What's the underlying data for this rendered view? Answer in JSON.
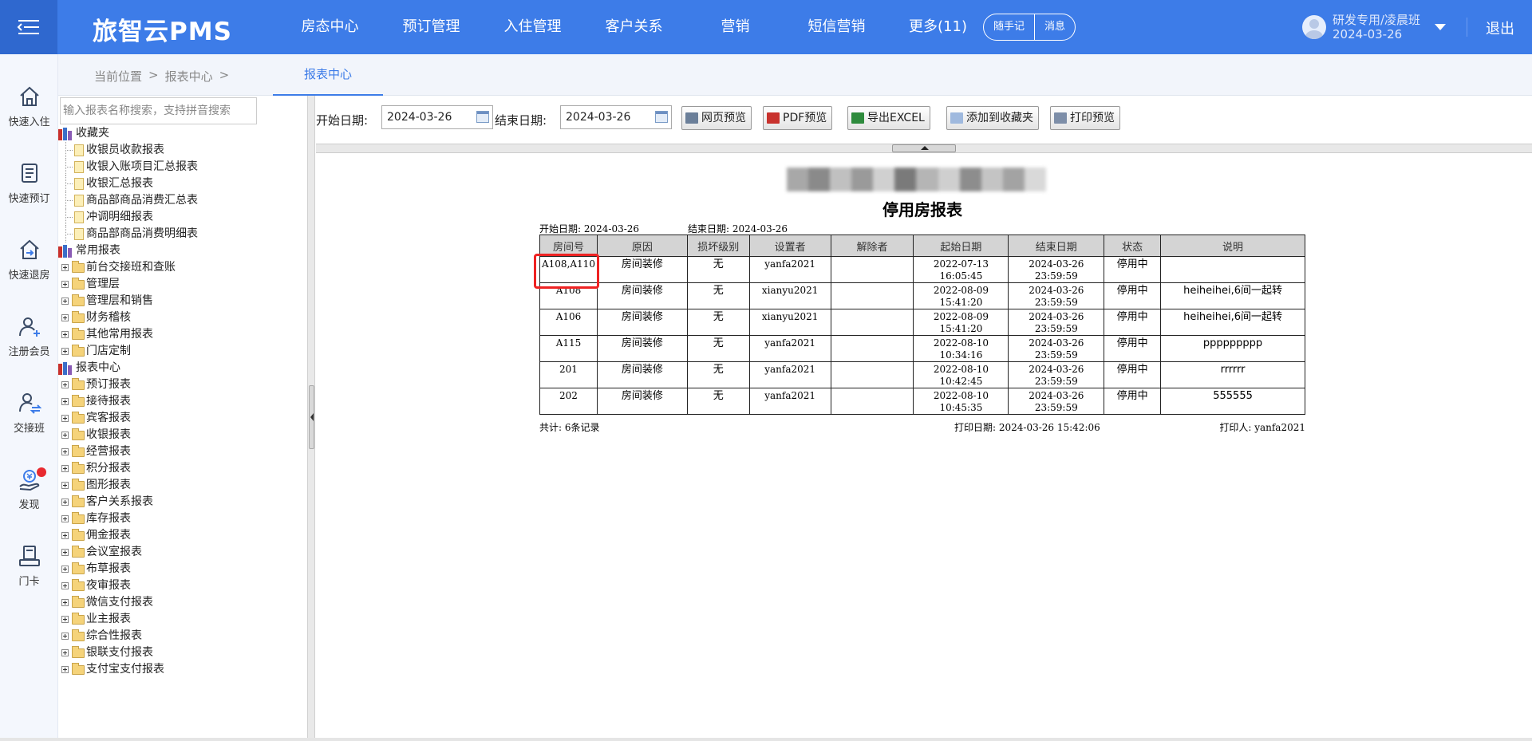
{
  "header": {
    "brand": "旅智云PMS",
    "nav": [
      "房态中心",
      "预订管理",
      "入住管理",
      "客户关系",
      "营销",
      "短信营销",
      "更多(11)"
    ],
    "pills": [
      "随手记",
      "消息"
    ],
    "user_name": "研发专用/凌晨班",
    "user_date": "2024-03-26",
    "logout": "退出"
  },
  "quick_actions": [
    {
      "label": "快速入住",
      "icon": "home-icon"
    },
    {
      "label": "快速预订",
      "icon": "booking-icon"
    },
    {
      "label": "快速退房",
      "icon": "checkout-icon"
    },
    {
      "label": "注册会员",
      "icon": "add-member-icon"
    },
    {
      "label": "交接班",
      "icon": "shift-handover-icon"
    },
    {
      "label": "发现",
      "icon": "discover-icon"
    },
    {
      "label": "门卡",
      "icon": "door-card-icon"
    }
  ],
  "breadcrumb": {
    "prefix": "当前位置",
    "sep": ">",
    "item": "报表中心",
    "tab": "报表中心"
  },
  "tree": {
    "search_placeholder": "输入报表名称搜索，支持拼音搜索",
    "favorites_label": "收藏夹",
    "favorites": [
      "收银员收款报表",
      "收银入账项目汇总报表",
      "收银汇总报表",
      "商品部商品消费汇总表",
      "冲调明细报表",
      "商品部商品消费明细表"
    ],
    "common_label": "常用报表",
    "common": [
      "前台交接班和查账",
      "管理层",
      "管理层和销售",
      "财务稽核",
      "其他常用报表",
      "门店定制"
    ],
    "center_label": "报表中心",
    "center": [
      "预订报表",
      "接待报表",
      "宾客报表",
      "收银报表",
      "经营报表",
      "积分报表",
      "图形报表",
      "客户关系报表",
      "库存报表",
      "佣金报表",
      "会议室报表",
      "布草报表",
      "夜审报表",
      "微信支付报表",
      "业主报表",
      "综合性报表",
      "银联支付报表",
      "支付宝支付报表"
    ]
  },
  "toolbar": {
    "start_label": "开始日期:",
    "start_value": "2024-03-26",
    "end_label": "结束日期:",
    "end_value": "2024-03-26",
    "buttons": [
      "网页预览",
      "PDF预览",
      "导出EXCEL",
      "添加到收藏夹",
      "打印预览"
    ]
  },
  "report": {
    "title": "停用房报表",
    "start": "开始日期: 2024-03-26",
    "end": "结束日期: 2024-03-26",
    "columns": [
      "房间号",
      "原因",
      "损坏级别",
      "设置者",
      "解除者",
      "起始日期",
      "结束日期",
      "状态",
      "说明"
    ],
    "rows": [
      {
        "room": "A108,A110",
        "reason": "房间装修",
        "level": "无",
        "setter": "yanfa2021",
        "releaser": "",
        "start1": "2022-07-13",
        "start2": "16:05:45",
        "end1": "2024-03-26",
        "end2": "23:59:59",
        "status": "停用中",
        "note": ""
      },
      {
        "room": "A108",
        "reason": "房间装修",
        "level": "无",
        "setter": "xianyu2021",
        "releaser": "",
        "start1": "2022-08-09",
        "start2": "15:41:20",
        "end1": "2024-03-26",
        "end2": "23:59:59",
        "status": "停用中",
        "note": "heiheihei,6间一起转"
      },
      {
        "room": "A106",
        "reason": "房间装修",
        "level": "无",
        "setter": "xianyu2021",
        "releaser": "",
        "start1": "2022-08-09",
        "start2": "15:41:20",
        "end1": "2024-03-26",
        "end2": "23:59:59",
        "status": "停用中",
        "note": "heiheihei,6间一起转"
      },
      {
        "room": "A115",
        "reason": "房间装修",
        "level": "无",
        "setter": "yanfa2021",
        "releaser": "",
        "start1": "2022-08-10",
        "start2": "10:34:16",
        "end1": "2024-03-26",
        "end2": "23:59:59",
        "status": "停用中",
        "note": "ppppppppp"
      },
      {
        "room": "201",
        "reason": "房间装修",
        "level": "无",
        "setter": "yanfa2021",
        "releaser": "",
        "start1": "2022-08-10",
        "start2": "10:42:45",
        "end1": "2024-03-26",
        "end2": "23:59:59",
        "status": "停用中",
        "note": "rrrrrr"
      },
      {
        "room": "202",
        "reason": "房间装修",
        "level": "无",
        "setter": "yanfa2021",
        "releaser": "",
        "start1": "2022-08-10",
        "start2": "10:45:35",
        "end1": "2024-03-26",
        "end2": "23:59:59",
        "status": "停用中",
        "note": "555555"
      }
    ],
    "total": "共计: 6条记录",
    "print_date": "打印日期: 2024-03-26 15:42:06",
    "printer": "打印人: yanfa2021"
  },
  "colors": {
    "primary": "#3d7ce8",
    "highlight": "#ee2222",
    "badge": "#e8292f"
  }
}
